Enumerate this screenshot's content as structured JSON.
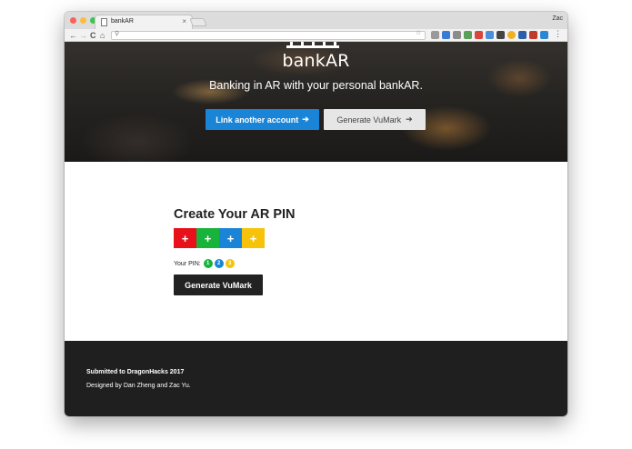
{
  "browser": {
    "tab_title": "bankAR",
    "tab_close": "×",
    "profile_name": "Zac",
    "nav": {
      "back": "←",
      "forward": "→",
      "reload": "C",
      "home": "⌂"
    },
    "menu": "⋮"
  },
  "hero": {
    "brand": "bankAR",
    "tagline": "Banking in AR with your personal bankAR.",
    "link_button": "Link another account",
    "generate_button": "Generate VuMark",
    "arrow": "➔"
  },
  "main": {
    "title": "Create Your AR PIN",
    "pads": [
      {
        "label": "+",
        "color": "#e8111b"
      },
      {
        "label": "+",
        "color": "#17b33a"
      },
      {
        "label": "+",
        "color": "#1a85d6"
      },
      {
        "label": "+",
        "color": "#f6c30a"
      }
    ],
    "pin_label": "Your PIN:",
    "pin_digits": [
      {
        "value": "1",
        "color": "#17b33a"
      },
      {
        "value": "2",
        "color": "#1a85d6"
      },
      {
        "value": "3",
        "color": "#f6c30a"
      }
    ],
    "generate_button": "Generate VuMark"
  },
  "footer": {
    "line1": "Submitted to DragonHacks 2017",
    "line2": "Designed by Dan Zheng and Zac Yu."
  }
}
